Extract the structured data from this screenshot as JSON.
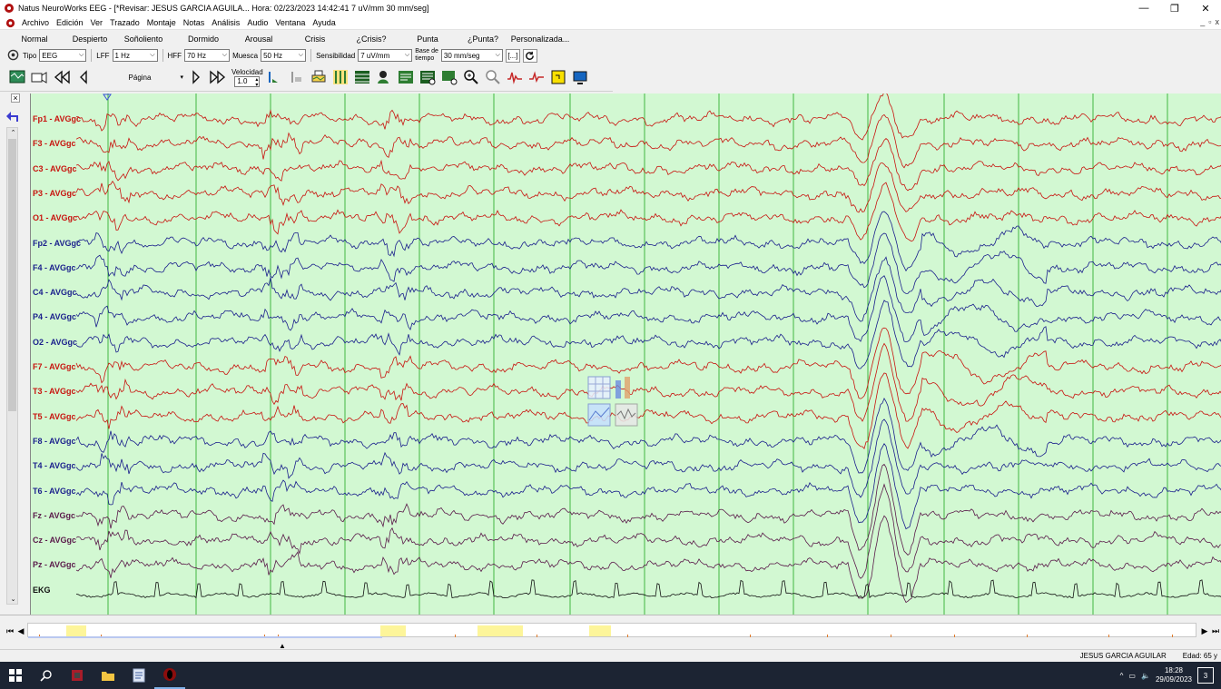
{
  "window": {
    "title": "Natus NeuroWorks EEG - [*Revisar:  JESUS  GARCIA AGUILA...   Hora: 02/23/2023 14:42:41   7 uV/mm   30 mm/seg]",
    "minimize": "—",
    "restore": "❐",
    "close": "✕"
  },
  "menu": {
    "items": [
      "Archivo",
      "Edición",
      "Ver",
      "Trazado",
      "Montaje",
      "Notas",
      "Análisis",
      "Audio",
      "Ventana",
      "Ayuda"
    ],
    "mdi": [
      "_",
      "▫",
      "x"
    ]
  },
  "states": [
    "Normal",
    "Despierto",
    "Soñoliento",
    "Dormido",
    "Arousal",
    "Crisis",
    "¿Crisis?",
    "Punta",
    "¿Punta?",
    "Personalizada..."
  ],
  "settings": {
    "tipo_label": "Tipo",
    "tipo_value": "EEG",
    "lff_label": "LFF",
    "lff_value": "1 Hz",
    "hff_label": "HFF",
    "hff_value": "70 Hz",
    "muesca_label": "Muesca",
    "muesca_value": "50 Hz",
    "sens_label": "Sensibilidad",
    "sens_value": "7 uV/mm",
    "base_label_1": "Base de",
    "base_label_2": "tiempo",
    "base_value": "30 mm/seg",
    "bracket_btn": "[...]"
  },
  "nav": {
    "page_label": "Página",
    "speed_label": "Velocidad",
    "speed_value": "1.0"
  },
  "channels": [
    {
      "label": "Fp1 - AVGgc",
      "color": "#c8140f"
    },
    {
      "label": "F3 - AVGgc",
      "color": "#c8140f"
    },
    {
      "label": "C3 - AVGgc",
      "color": "#c8140f"
    },
    {
      "label": "P3 - AVGgc",
      "color": "#c8140f"
    },
    {
      "label": "O1 - AVGgc",
      "color": "#c8140f"
    },
    {
      "label": "Fp2 - AVGgc",
      "color": "#1a1f8c"
    },
    {
      "label": "F4 - AVGgc",
      "color": "#1a1f8c"
    },
    {
      "label": "C4 - AVGgc",
      "color": "#1a1f8c"
    },
    {
      "label": "P4 - AVGgc",
      "color": "#1a1f8c"
    },
    {
      "label": "O2 - AVGgc",
      "color": "#1a1f8c"
    },
    {
      "label": "F7 - AVGgc",
      "color": "#c8140f"
    },
    {
      "label": "T3 - AVGgc",
      "color": "#c8140f"
    },
    {
      "label": "T5 - AVGgc",
      "color": "#c8140f"
    },
    {
      "label": "F8 - AVGgc",
      "color": "#1a1f8c"
    },
    {
      "label": "T4 - AVGgc",
      "color": "#1a1f8c"
    },
    {
      "label": "T6 - AVGgc",
      "color": "#1a1f8c"
    },
    {
      "label": "Fz - AVGgc",
      "color": "#5a1a4a"
    },
    {
      "label": "Cz - AVGgc",
      "color": "#5a1a4a"
    },
    {
      "label": "Pz - AVGgc",
      "color": "#5a1a4a"
    },
    {
      "label": "EKG",
      "color": "#111111"
    }
  ],
  "colors": {
    "background": "#d2f8d2",
    "gridline": "#1ea61e",
    "marker": "#3a4fd8",
    "taskbar": "#1c2433"
  },
  "status": {
    "patient": "JESUS  GARCIA AGUILAR",
    "age": "Edad: 65 y"
  },
  "taskbar": {
    "time": "18:28",
    "date": "29/09/2023",
    "notifications": "3"
  }
}
